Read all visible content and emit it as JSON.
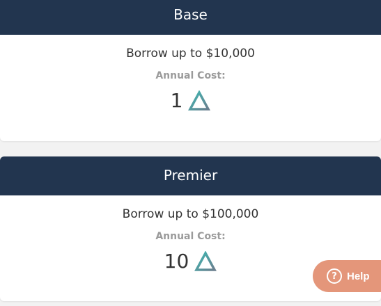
{
  "plans": [
    {
      "name": "Base",
      "borrow_text": "Borrow up to $10,000",
      "cost_label": "Annual Cost:",
      "cost_value": "1",
      "currency_icon": "delta-triangle-icon"
    },
    {
      "name": "Premier",
      "borrow_text": "Borrow up to $100,000",
      "cost_label": "Annual Cost:",
      "cost_value": "10",
      "currency_icon": "delta-triangle-icon"
    }
  ],
  "help": {
    "icon": "question-circle-icon",
    "label": "Help"
  },
  "colors": {
    "header_bg": "#22354f",
    "page_bg": "#f2f2f2",
    "help_bg": "#e4967a",
    "triangle_gradient_start": "#3fb6b1",
    "triangle_gradient_end": "#6b7e8e"
  }
}
